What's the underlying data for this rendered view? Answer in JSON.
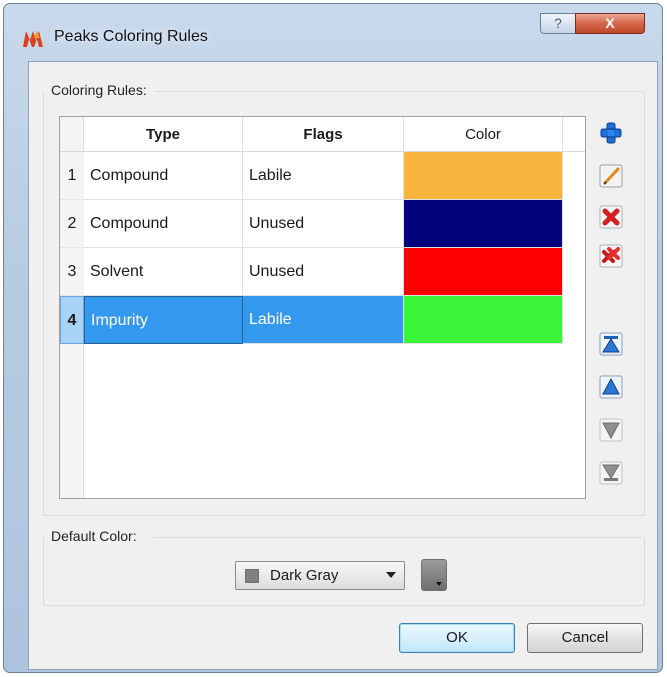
{
  "window": {
    "title": "Peaks Coloring Rules",
    "help_label": "?",
    "close_label": "X"
  },
  "rules_group": {
    "label": "Coloring Rules:",
    "columns": [
      "Type",
      "Flags",
      "Color"
    ],
    "rows": [
      {
        "num": "1",
        "type": "Compound",
        "flags": "Labile",
        "color": "#f9b63e",
        "selected": false
      },
      {
        "num": "2",
        "type": "Compound",
        "flags": "Unused",
        "color": "#03037d",
        "selected": false
      },
      {
        "num": "3",
        "type": "Solvent",
        "flags": "Unused",
        "color": "#fe0000",
        "selected": false
      },
      {
        "num": "4",
        "type": "Impurity",
        "flags": "Labile",
        "color": "#3af53a",
        "selected": true
      }
    ]
  },
  "toolbar": {
    "icons": [
      "add-icon",
      "edit-icon",
      "delete-icon",
      "delete-all-icon",
      "move-top-icon",
      "move-up-icon",
      "move-down-icon",
      "move-bottom-icon"
    ],
    "enabled": [
      true,
      true,
      true,
      true,
      true,
      true,
      false,
      false
    ]
  },
  "default_group": {
    "label": "Default Color:",
    "selected_value": "Dark Gray",
    "swatch_color": "#808080"
  },
  "buttons": {
    "ok": "OK",
    "cancel": "Cancel"
  }
}
